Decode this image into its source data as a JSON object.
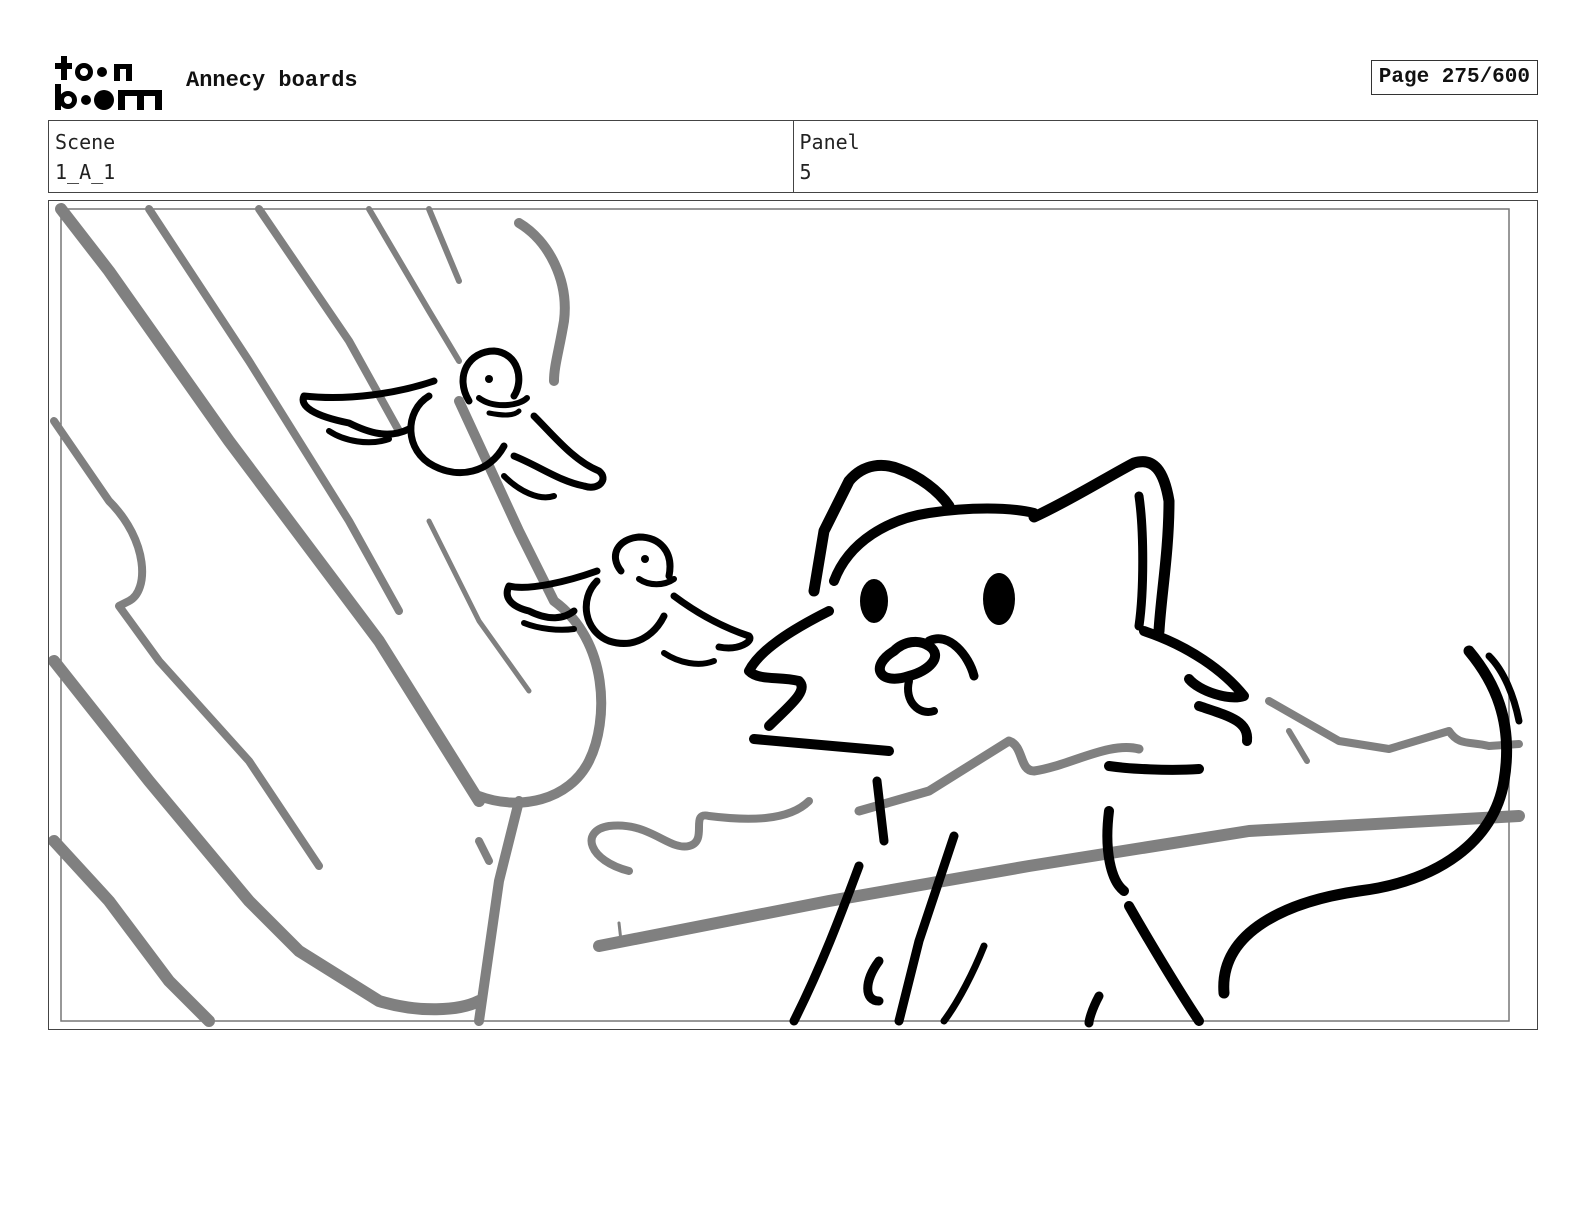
{
  "header": {
    "logo_text": "toonboom",
    "title": "Annecy boards",
    "page_label": "Page 275/600"
  },
  "scene": {
    "label": "Scene",
    "value": "1_A_1"
  },
  "panel": {
    "label": "Panel",
    "value": "5"
  },
  "colors": {
    "ink": "#000000",
    "sketch_gray": "#808080",
    "border": "#444444"
  }
}
